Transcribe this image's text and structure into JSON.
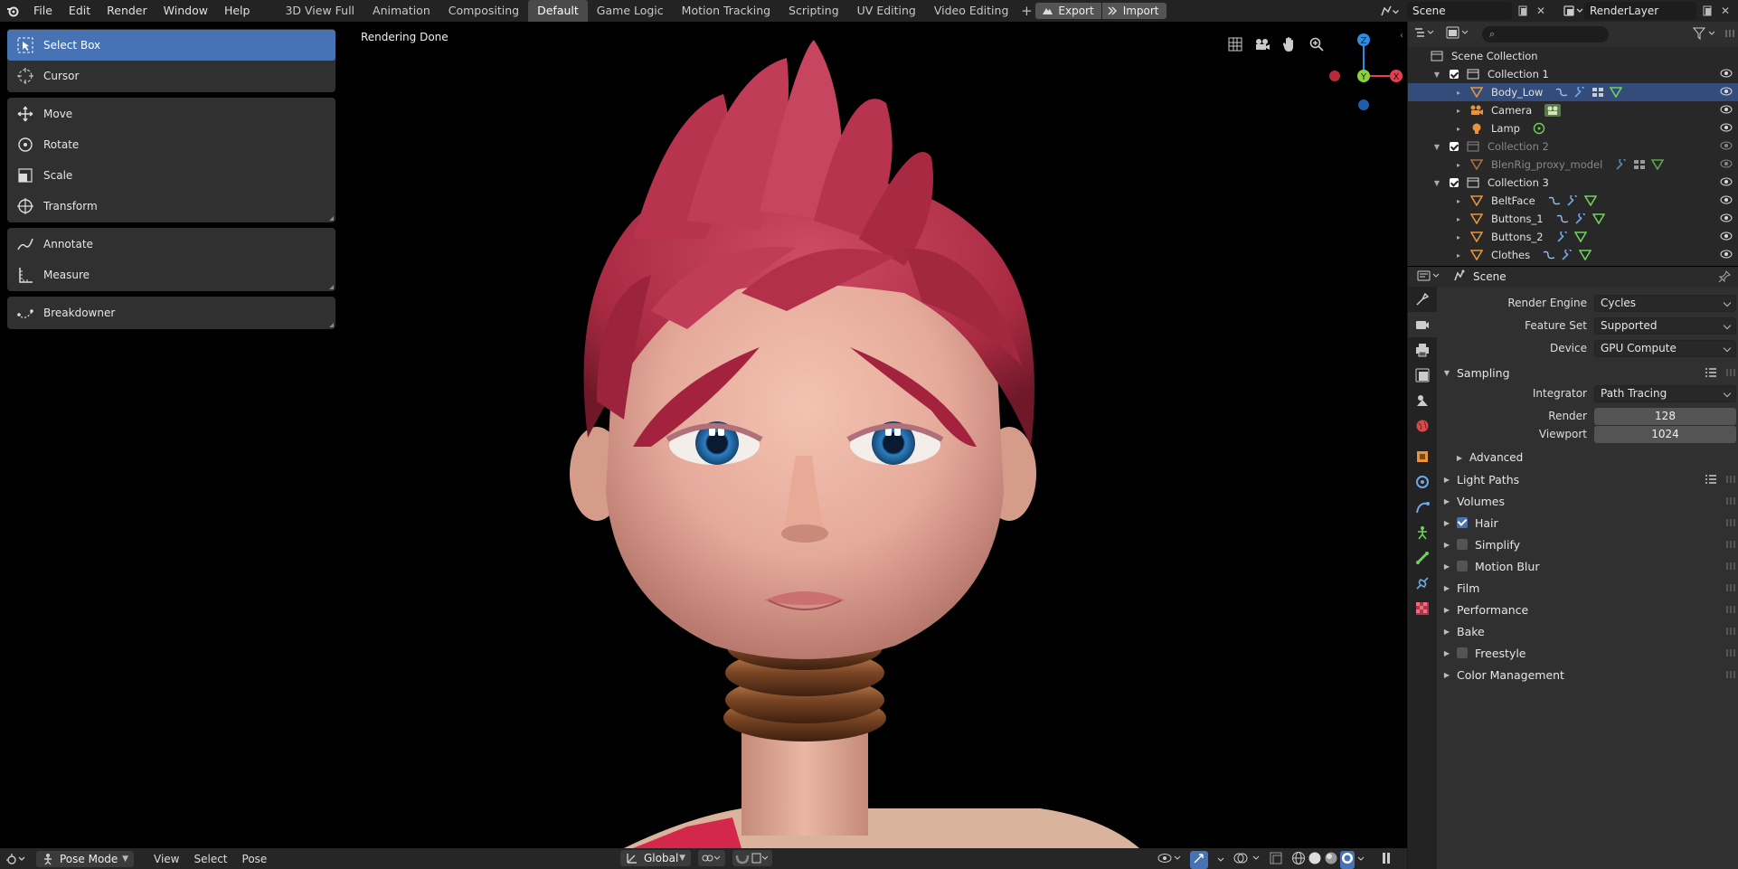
{
  "topbar": {
    "menus": [
      "File",
      "Edit",
      "Render",
      "Window",
      "Help"
    ],
    "workspaces": [
      "3D View Full",
      "Animation",
      "Compositing",
      "Default",
      "Game Logic",
      "Motion Tracking",
      "Scripting",
      "UV Editing",
      "Video Editing"
    ],
    "active_workspace": "Default",
    "export_label": "Export",
    "import_label": "Import",
    "scene_name": "Scene",
    "view_layer": "RenderLayer"
  },
  "toolbar": {
    "groups": [
      [
        {
          "label": "Select Box",
          "icon": "select-box-icon",
          "active": true
        },
        {
          "label": "Cursor",
          "icon": "cursor-icon"
        }
      ],
      [
        {
          "label": "Move",
          "icon": "move-icon"
        },
        {
          "label": "Rotate",
          "icon": "rotate-icon"
        },
        {
          "label": "Scale",
          "icon": "scale-icon"
        },
        {
          "label": "Transform",
          "icon": "transform-icon"
        }
      ],
      [
        {
          "label": "Annotate",
          "icon": "annotate-icon"
        },
        {
          "label": "Measure",
          "icon": "measure-icon"
        }
      ],
      [
        {
          "label": "Breakdowner",
          "icon": "breakdowner-icon"
        }
      ]
    ]
  },
  "viewport": {
    "status": "Rendering Done",
    "gizmo": {
      "z": "Z",
      "y": "Y",
      "x": "X"
    }
  },
  "bottombar": {
    "mode": "Pose Mode",
    "menus": [
      "View",
      "Select",
      "Pose"
    ],
    "orientation": "Global"
  },
  "outliner": {
    "root": "Scene Collection",
    "rows": [
      {
        "name": "Collection 1",
        "type": "collection",
        "indent": 1,
        "expanded": true
      },
      {
        "name": "Body_Low",
        "type": "mesh",
        "indent": 2,
        "selected": true
      },
      {
        "name": "Camera",
        "type": "camera",
        "indent": 2
      },
      {
        "name": "Lamp",
        "type": "light",
        "indent": 2
      },
      {
        "name": "Collection 2",
        "type": "collection",
        "indent": 1,
        "expanded": true,
        "dim": true
      },
      {
        "name": "BlenRig_proxy_model",
        "type": "mesh",
        "indent": 2,
        "dim": true
      },
      {
        "name": "Collection 3",
        "type": "collection",
        "indent": 1,
        "expanded": true
      },
      {
        "name": "BeltFace",
        "type": "mesh",
        "indent": 2
      },
      {
        "name": "Buttons_1",
        "type": "mesh",
        "indent": 2
      },
      {
        "name": "Buttons_2",
        "type": "mesh",
        "indent": 2
      },
      {
        "name": "Clothes",
        "type": "mesh",
        "indent": 2
      }
    ]
  },
  "properties": {
    "context": "Scene",
    "render_engine_label": "Render Engine",
    "render_engine": "Cycles",
    "feature_set_label": "Feature Set",
    "feature_set": "Supported",
    "device_label": "Device",
    "device": "GPU Compute",
    "sampling": {
      "title": "Sampling",
      "integrator_label": "Integrator",
      "integrator": "Path Tracing",
      "render_label": "Render",
      "render": "128",
      "viewport_label": "Viewport",
      "viewport": "1024",
      "advanced": "Advanced"
    },
    "panels": [
      {
        "title": "Light Paths",
        "list": true
      },
      {
        "title": "Volumes"
      },
      {
        "title": "Hair",
        "checkbox": true,
        "checked": true
      },
      {
        "title": "Simplify",
        "checkbox": true,
        "checked": false
      },
      {
        "title": "Motion Blur",
        "checkbox": true,
        "checked": false
      },
      {
        "title": "Film"
      },
      {
        "title": "Performance"
      },
      {
        "title": "Bake"
      },
      {
        "title": "Freestyle",
        "checkbox": true,
        "checked": false
      },
      {
        "title": "Color Management"
      }
    ]
  },
  "colors": {
    "accent": "#4772b3",
    "selected_row": "#344c7a",
    "mesh": "#e8943a",
    "hair": "#b8334a"
  }
}
